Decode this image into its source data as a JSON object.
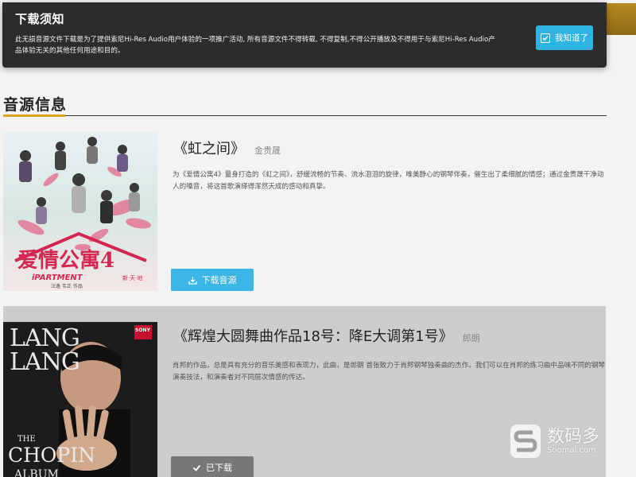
{
  "notice": {
    "title": "下载须知",
    "body": "此无损音源文件下载是为了提供索尼Hi-Res Audio用户体验的一项推广活动, 所有音源文件不得转载, 不得复制,不得公开播放及不得用于与索尼Hi-Res Audio产品体验无关的其他任何用途和目的。",
    "confirm_label": "我知道了"
  },
  "section": {
    "title": "音源信息"
  },
  "tracks": [
    {
      "title": "《虹之间》",
      "artist": "金贵晟",
      "description": "为《爱情公寓4》量身打造的《虹之间》，舒缓流畅的节奏、流水泪泪的旋律，唯美静心的钢琴伴奏，催生出了柔细腻的情感；通过金贵晟干净动人的嗓音，将这首歌演绎得浑然天成的感动和真挚。",
      "action_label": "下载音源",
      "cover": {
        "title": "爱情公寓4",
        "subtitle": "iPARTMENT",
        "corner": "新·天·地",
        "credits": "汪逸    韦正    作品"
      }
    },
    {
      "title": "《辉煌大圆舞曲作品18号：降E大调第1号》",
      "artist": "郎朗",
      "description": "肖邦的作品，总是具有充分的音乐美感和表现力，此曲，是郎朗 首张致力于肖邦钢琴独奏曲的杰作。我们可以在肖邦的练习曲中品味不同的钢琴演奏技法，和演奏者对不同层次情感的传达。",
      "action_label": "已下载",
      "cover": {
        "artist_line1": "LANG",
        "artist_line2": "LANG",
        "album_line1": "THE",
        "album_line2": "CHOPIN",
        "album_line3": "ALBUM",
        "label": "SONY"
      }
    }
  ],
  "watermark": {
    "text": "数码多",
    "sub": "Soomal.com"
  },
  "colors": {
    "accent_blue": "#3cb6e6",
    "gold_accent": "#d9a51b",
    "notice_bg": "#2c2c2c"
  }
}
